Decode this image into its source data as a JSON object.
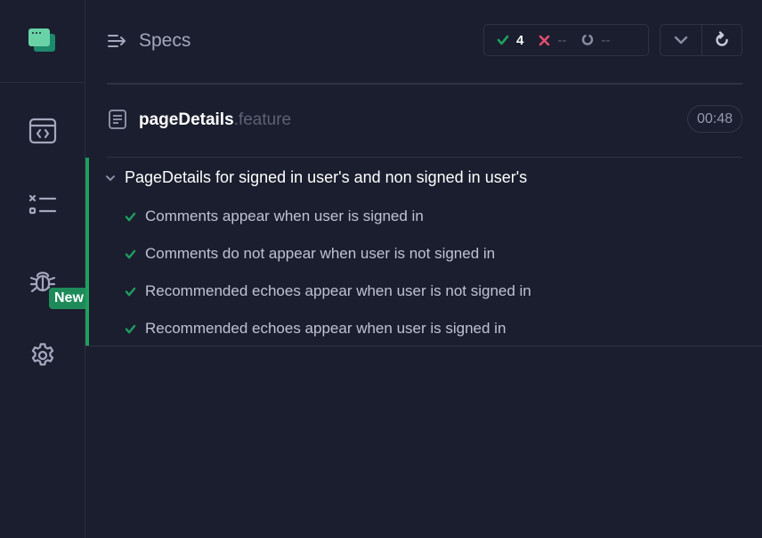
{
  "header": {
    "title": "Specs",
    "stats": {
      "passed": "4",
      "failed": "--",
      "pending": "--"
    }
  },
  "sidebar": {
    "items": [
      {
        "name": "specs-nav-icon"
      },
      {
        "name": "runs-nav-icon"
      },
      {
        "name": "debug-nav-icon",
        "badge": "New"
      },
      {
        "name": "settings-nav-icon"
      }
    ]
  },
  "file": {
    "base": "pageDetails",
    "ext": ".feature",
    "duration": "00:48"
  },
  "suite": {
    "title": "PageDetails for signed in user's and non signed in user's",
    "tests": [
      {
        "label": "Comments appear when user is signed in",
        "status": "passed"
      },
      {
        "label": "Comments do not appear when user is not signed in",
        "status": "passed"
      },
      {
        "label": "Recommended echoes appear when user is not signed in",
        "status": "passed"
      },
      {
        "label": "Recommended echoes appear when user is signed in",
        "status": "passed"
      }
    ]
  },
  "colors": {
    "background": "#1b1e2e",
    "pass": "#1e9e5f",
    "fail": "#e04e6f",
    "brand": "#69d3a7"
  }
}
